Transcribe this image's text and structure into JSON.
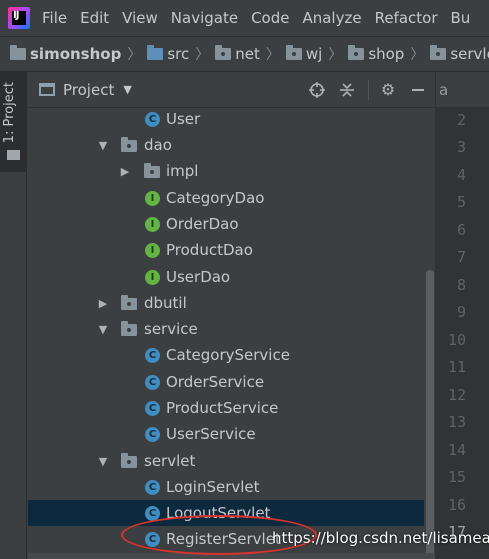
{
  "menubar": {
    "logo_text": "IJ",
    "items": [
      "File",
      "Edit",
      "View",
      "Navigate",
      "Code",
      "Analyze",
      "Refactor",
      "Bu"
    ]
  },
  "breadcrumbs": [
    "simonshop",
    "src",
    "net",
    "wj",
    "shop",
    "servlet"
  ],
  "sidebar": {
    "tab_label": "1: Project"
  },
  "project_panel": {
    "title": "Project",
    "icons": [
      "crosshair-icon",
      "collapse-all-icon",
      "gear-icon",
      "minimize-icon"
    ]
  },
  "tree": [
    {
      "label": "User",
      "kind": "class",
      "letter": "C"
    },
    {
      "label": "dao",
      "kind": "package",
      "expanded": true
    },
    {
      "label": "impl",
      "kind": "package",
      "expanded": false
    },
    {
      "label": "CategoryDao",
      "kind": "interface",
      "letter": "I"
    },
    {
      "label": "OrderDao",
      "kind": "interface",
      "letter": "I"
    },
    {
      "label": "ProductDao",
      "kind": "interface",
      "letter": "I"
    },
    {
      "label": "UserDao",
      "kind": "interface",
      "letter": "I"
    },
    {
      "label": "dbutil",
      "kind": "package",
      "expanded": false
    },
    {
      "label": "service",
      "kind": "package",
      "expanded": true
    },
    {
      "label": "CategoryService",
      "kind": "class",
      "letter": "C"
    },
    {
      "label": "OrderService",
      "kind": "class",
      "letter": "C"
    },
    {
      "label": "ProductService",
      "kind": "class",
      "letter": "C"
    },
    {
      "label": "UserService",
      "kind": "class",
      "letter": "C"
    },
    {
      "label": "servlet",
      "kind": "package",
      "expanded": true
    },
    {
      "label": "LoginServlet",
      "kind": "class",
      "letter": "C"
    },
    {
      "label": "LogoutServlet",
      "kind": "class",
      "letter": "C",
      "selected": true
    },
    {
      "label": "RegisterServlet",
      "kind": "class",
      "letter": "C"
    }
  ],
  "editor": {
    "tab_text": "a",
    "line_numbers": [
      "2",
      "3",
      "4",
      "5",
      "6",
      "7",
      "8",
      "9",
      "10",
      "11",
      "12",
      "13",
      "14",
      "15",
      "16",
      "17"
    ],
    "current_line": "17"
  },
  "watermark": "https://blog.csdn.net/lisameal",
  "colors": {
    "background": "#3c3f41",
    "selection": "#0d293e",
    "class_icon": "#3e8ec3",
    "interface_icon": "#62b543",
    "annotation": "#d8332d"
  }
}
